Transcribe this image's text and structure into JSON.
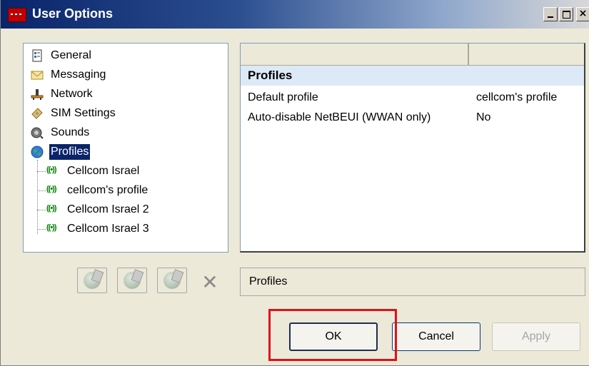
{
  "window": {
    "title": "User Options"
  },
  "tree": {
    "items": [
      {
        "label": "General",
        "icon": "general-icon"
      },
      {
        "label": "Messaging",
        "icon": "envelope-icon"
      },
      {
        "label": "Network",
        "icon": "network-icon"
      },
      {
        "label": "SIM Settings",
        "icon": "sim-card-icon"
      },
      {
        "label": "Sounds",
        "icon": "speaker-icon"
      },
      {
        "label": "Profiles",
        "icon": "globe-icon",
        "selected": true
      }
    ],
    "profiles": [
      {
        "label": "Cellcom Israel",
        "icon": "antenna-icon"
      },
      {
        "label": "cellcom's profile",
        "icon": "antenna-icon"
      },
      {
        "label": "Cellcom Israel 2",
        "icon": "antenna-icon"
      },
      {
        "label": "Cellcom Israel 3",
        "icon": "antenna-icon"
      }
    ],
    "antenna_glyph": "((•))"
  },
  "grid": {
    "section": "Profiles",
    "rows": [
      {
        "name": "Default profile",
        "value": "cellcom's profile"
      },
      {
        "name": "Auto-disable NetBEUI (WWAN only)",
        "value": "No"
      }
    ]
  },
  "toolbar": {
    "delete_glyph": "✕"
  },
  "status": {
    "text": "Profiles"
  },
  "buttons": {
    "ok": "OK",
    "cancel": "Cancel",
    "apply": "Apply"
  },
  "colors": {
    "selection": "#0a246a",
    "section_bg": "#dde9f7",
    "highlight": "#e0101a"
  }
}
